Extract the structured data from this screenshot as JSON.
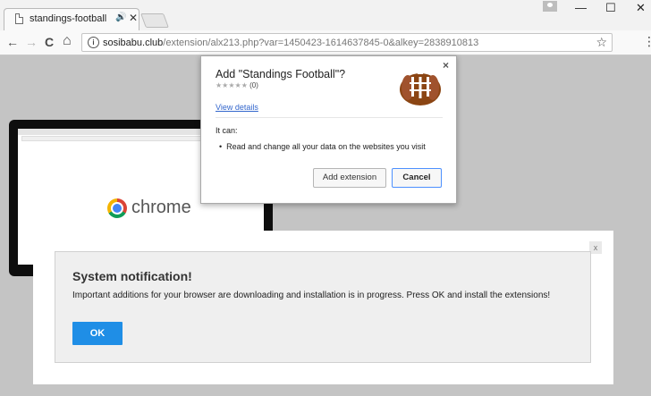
{
  "browser": {
    "tab_title": "standings-football",
    "tab_close": "✕",
    "audio_icon": "🔊",
    "window_controls": {
      "minimize": "—",
      "maximize": "☐",
      "close": "✕"
    }
  },
  "nav": {
    "back": "←",
    "forward": "→",
    "reload": "C",
    "home": "⌂",
    "info": "i",
    "url_host": "sosibabu.club",
    "url_path": "/extension/alx213.php?var=1450423-1614637845-0&alkey=2838910813",
    "bookmark_star": "☆",
    "menu": "⋮"
  },
  "background_page": {
    "chrome_word": "chrome"
  },
  "extension_dialog": {
    "title": "Add \"Standings Football\"?",
    "stars": "★★★★★",
    "rating_count": "(0)",
    "view_details": "View details",
    "it_can": "It can:",
    "permissions": [
      "Read and change all your data on the websites you visit"
    ],
    "add_button": "Add extension",
    "cancel_button": "Cancel",
    "close": "×",
    "icon": "football-icon"
  },
  "notification": {
    "close": "x",
    "title": "System notification!",
    "body": "Important additions for your browser are downloading and installation is in progress. Press OK and install the extensions!",
    "ok_button": "OK"
  },
  "colors": {
    "accent_blue": "#1f8ee6",
    "link_blue": "#3366cc",
    "football_brown": "#8b4513"
  }
}
